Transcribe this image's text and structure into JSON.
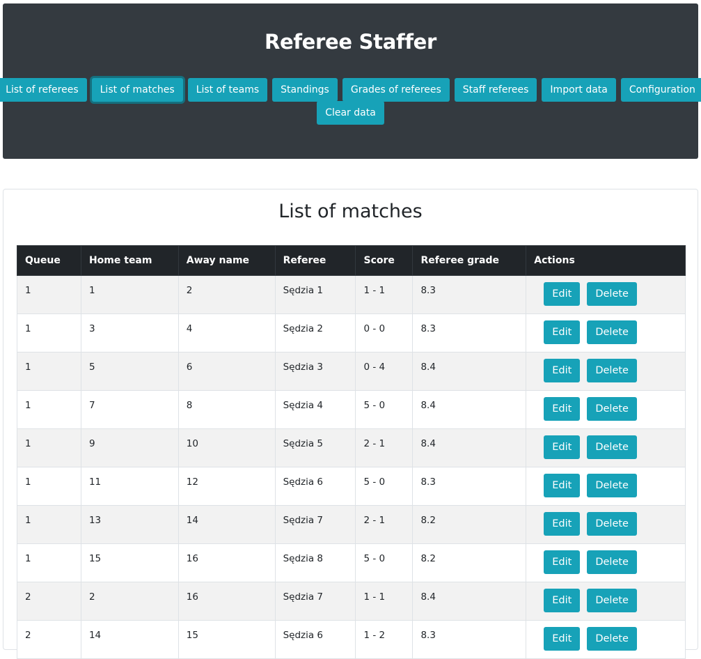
{
  "header": {
    "title": "Referee Staffer",
    "nav": [
      {
        "label": "List of referees",
        "name": "nav-list-of-referees"
      },
      {
        "label": "List of matches",
        "name": "nav-list-of-matches",
        "active": true
      },
      {
        "label": "List of teams",
        "name": "nav-list-of-teams"
      },
      {
        "label": "Standings",
        "name": "nav-standings"
      },
      {
        "label": "Grades of referees",
        "name": "nav-grades-of-referees"
      },
      {
        "label": "Staff referees",
        "name": "nav-staff-referees"
      },
      {
        "label": "Import data",
        "name": "nav-import-data"
      },
      {
        "label": "Configuration",
        "name": "nav-configuration"
      },
      {
        "label": "Clear data",
        "name": "nav-clear-data"
      }
    ]
  },
  "main": {
    "title": "List of matches",
    "columns": [
      "Queue",
      "Home team",
      "Away name",
      "Referee",
      "Score",
      "Referee grade",
      "Actions"
    ],
    "edit_label": "Edit",
    "delete_label": "Delete",
    "rows": [
      {
        "queue": "1",
        "home": "1",
        "away": "2",
        "referee": "Sędzia 1",
        "score": "1 - 1",
        "grade": "8.3"
      },
      {
        "queue": "1",
        "home": "3",
        "away": "4",
        "referee": "Sędzia 2",
        "score": "0 - 0",
        "grade": "8.3"
      },
      {
        "queue": "1",
        "home": "5",
        "away": "6",
        "referee": "Sędzia 3",
        "score": "0 - 4",
        "grade": "8.4"
      },
      {
        "queue": "1",
        "home": "7",
        "away": "8",
        "referee": "Sędzia 4",
        "score": "5 - 0",
        "grade": "8.4"
      },
      {
        "queue": "1",
        "home": "9",
        "away": "10",
        "referee": "Sędzia 5",
        "score": "2 - 1",
        "grade": "8.4"
      },
      {
        "queue": "1",
        "home": "11",
        "away": "12",
        "referee": "Sędzia 6",
        "score": "5 - 0",
        "grade": "8.3"
      },
      {
        "queue": "1",
        "home": "13",
        "away": "14",
        "referee": "Sędzia 7",
        "score": "2 - 1",
        "grade": "8.2"
      },
      {
        "queue": "1",
        "home": "15",
        "away": "16",
        "referee": "Sędzia 8",
        "score": "5 - 0",
        "grade": "8.2"
      },
      {
        "queue": "2",
        "home": "2",
        "away": "16",
        "referee": "Sędzia 7",
        "score": "1 - 1",
        "grade": "8.4"
      },
      {
        "queue": "2",
        "home": "14",
        "away": "15",
        "referee": "Sędzia 6",
        "score": "1 - 2",
        "grade": "8.3"
      }
    ]
  },
  "colors": {
    "accent": "#17a2b8",
    "header_bg": "#343a40",
    "table_head": "#212529"
  }
}
